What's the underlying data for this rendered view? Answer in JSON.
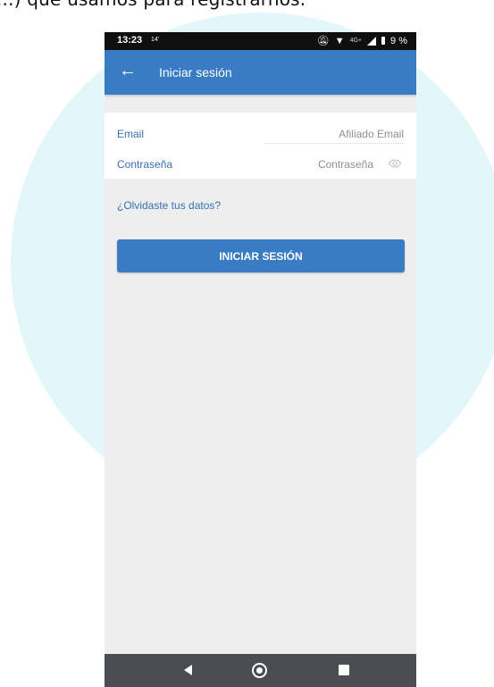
{
  "caption": "...) que usamos para registrarnos.",
  "status_bar": {
    "time": "13:23",
    "small_indicator": "14'",
    "network": "4G+",
    "battery": "9 %"
  },
  "appbar": {
    "title": "Iniciar sesión"
  },
  "form": {
    "email": {
      "label": "Email",
      "placeholder": "Afiliado Email"
    },
    "password": {
      "label": "Contraseña",
      "placeholder": "Contraseña"
    }
  },
  "links": {
    "forgot": "¿Olvidaste tus datos?"
  },
  "buttons": {
    "login": "INICIAR SESIÓN"
  },
  "icons": {
    "back": "back-arrow-icon",
    "eye": "eye-icon"
  }
}
